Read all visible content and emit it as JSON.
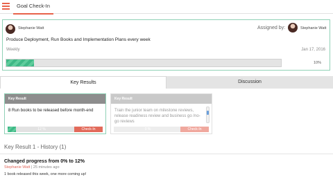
{
  "header": {
    "menu_icon": "hamburger-menu-icon",
    "accent_color": "#e8624a",
    "active_tab": "Goal Check-In"
  },
  "goal": {
    "owner_name": "Stephanie Watt",
    "assigned_label": "Assigned by:",
    "assigner_name": "Stephanie Watt",
    "title": "Produce Deployment, Run Books and Implementation Plans every week",
    "frequency": "Weekly",
    "date": "Jan 17, 2016",
    "progress_percent": 10,
    "progress_label": "10%",
    "progress_color": "#3fb886"
  },
  "tabs": [
    {
      "label": "Key Results",
      "active": true
    },
    {
      "label": "Discussion",
      "active": false
    }
  ],
  "key_results": [
    {
      "heading": "Key Result",
      "text": "8 Run books to be released before month-end",
      "progress_percent": 12,
      "progress_label": "12 %",
      "button": "Check-In"
    },
    {
      "heading": "Key Result",
      "text": "Train the junior team on milestone reviews, release readiness review and business go /no-go reviews",
      "progress_percent": 0,
      "progress_label": "0 %",
      "button": "Check-In"
    }
  ],
  "history": {
    "title": "Key Result 1 - History (1)",
    "entries": [
      {
        "title": "Changed progress from 0% to 12%",
        "author": "Stephanie Watt",
        "time": " | 25 minutes ago",
        "body": "1 book released this week, one more coming up!"
      }
    ]
  }
}
